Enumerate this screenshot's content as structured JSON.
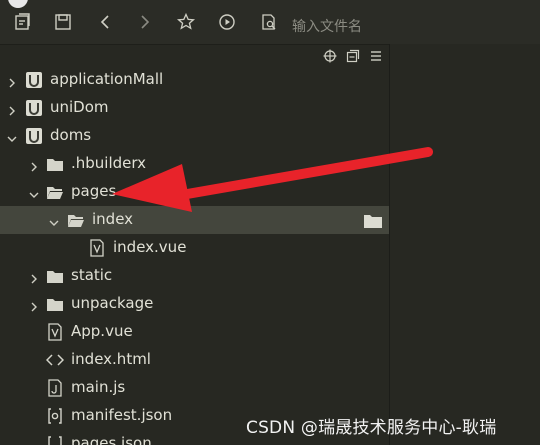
{
  "toolbar": {
    "search_placeholder": "输入文件名",
    "icons": [
      "file-history-icon",
      "save-icon",
      "back-icon",
      "forward-icon",
      "star-icon",
      "run-icon",
      "search-file-icon"
    ]
  },
  "panel_actions": {
    "icons": [
      "locate-icon",
      "collapse-all-icon",
      "menu-icon"
    ]
  },
  "tree": {
    "items": [
      {
        "label": "applicationMall",
        "type": "project",
        "expanded": false
      },
      {
        "label": "uniDom",
        "type": "project",
        "expanded": false
      },
      {
        "label": "doms",
        "type": "project",
        "expanded": true
      },
      {
        "label": ".hbuilderx",
        "type": "folder",
        "expanded": false
      },
      {
        "label": "pages",
        "type": "folder",
        "expanded": true
      },
      {
        "label": "index",
        "type": "folder",
        "expanded": true,
        "selected": true
      },
      {
        "label": "index.vue",
        "type": "vue-file"
      },
      {
        "label": "static",
        "type": "folder",
        "expanded": false
      },
      {
        "label": "unpackage",
        "type": "folder",
        "expanded": false
      },
      {
        "label": "App.vue",
        "type": "vue-file"
      },
      {
        "label": "index.html",
        "type": "html-file"
      },
      {
        "label": "main.js",
        "type": "js-file"
      },
      {
        "label": "manifest.json",
        "type": "json-file"
      },
      {
        "label": "pages.json",
        "type": "json-file"
      }
    ]
  },
  "annotation": {
    "color": "#e8232a"
  },
  "watermark": "CSDN @瑞晟技术服务中心-耿瑞"
}
